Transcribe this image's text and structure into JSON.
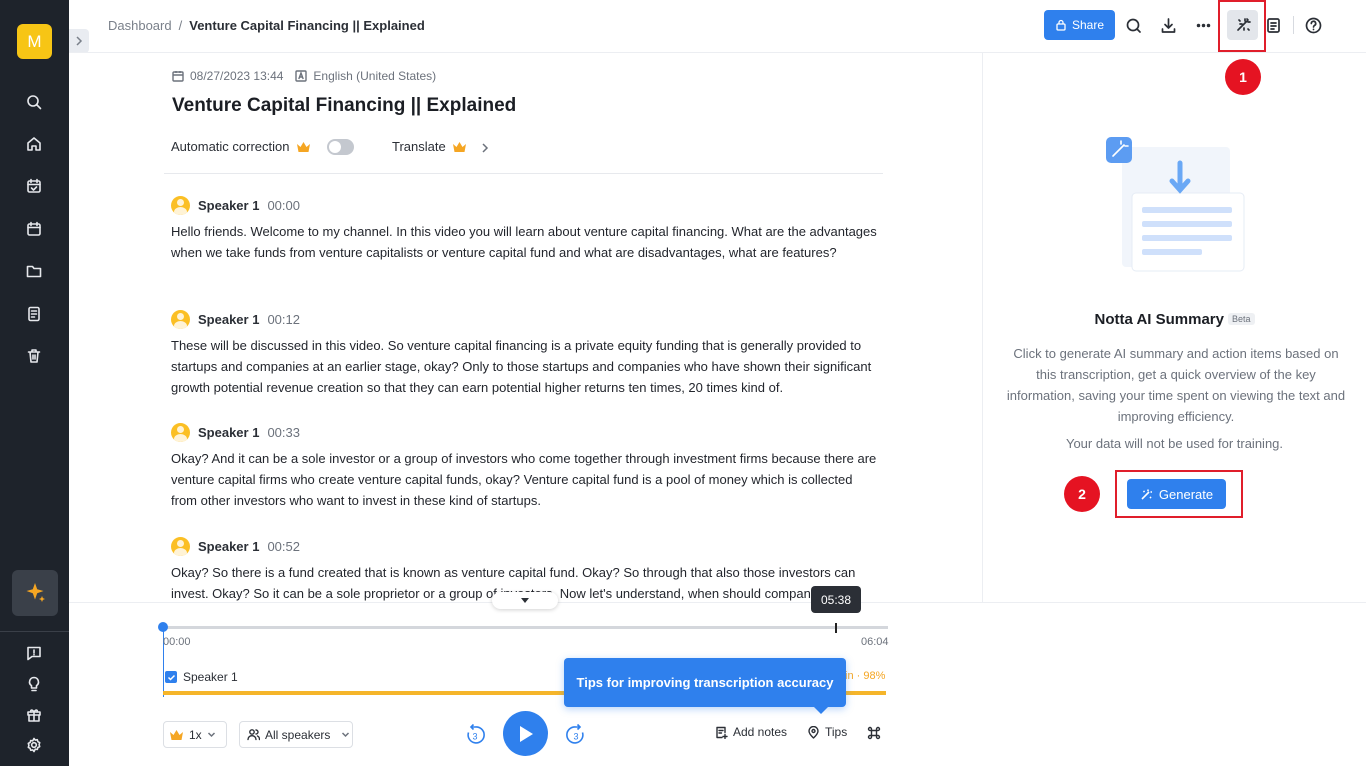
{
  "sidebar": {
    "avatar_letter": "M",
    "nav_icons": [
      "search-icon",
      "home-icon",
      "calendar-check-icon",
      "calendar-icon",
      "folder-icon",
      "notes-icon",
      "trash-icon"
    ],
    "ai_icon": "sparkle-icon",
    "bottom_icons": [
      "feedback-icon",
      "lightbulb-icon",
      "gift-icon",
      "settings-icon"
    ]
  },
  "header": {
    "breadcrumb_root": "Dashboard",
    "breadcrumb_separator": "/",
    "breadcrumb_current": "Venture Capital Financing || Explained",
    "share_label": "Share"
  },
  "annotations": {
    "step1": "1",
    "step2": "2",
    "highlight_color": "#e01e2b"
  },
  "document": {
    "date": "08/27/2023 13:44",
    "language": "English (United States)",
    "title": "Venture Capital Financing || Explained",
    "auto_correction_label": "Automatic correction",
    "translate_label": "Translate"
  },
  "transcript": [
    {
      "speaker": "Speaker 1",
      "time": "00:00",
      "text": "Hello friends. Welcome to my channel. In this video you will learn about venture capital financing. What are the advantages when we take funds from venture capitalists or venture capital fund and what are disadvantages, what are features?"
    },
    {
      "speaker": "Speaker 1",
      "time": "00:12",
      "text": "These will be discussed in this video. So venture capital financing is a private equity funding that is generally provided to startups and companies at an earlier stage, okay? Only to those startups and companies who have shown their significant growth potential revenue creation so that they can earn potential higher returns ten times, 20 times kind of."
    },
    {
      "speaker": "Speaker 1",
      "time": "00:33",
      "text": "Okay? And it can be a sole investor or a group of investors who come together through investment firms because there are venture capital firms who create venture capital funds, okay? Venture capital fund is a pool of money which is collected from other investors who want to invest in these kind of startups."
    },
    {
      "speaker": "Speaker 1",
      "time": "00:52",
      "text": "Okay? So there is a fund created that is known as venture capital fund. Okay? So through that also those investors can invest. Okay? So it can be a sole proprietor or a group of investors. Now let's understand, when should companies go"
    }
  ],
  "summary_panel": {
    "title": "Notta AI Summary",
    "badge": "Beta",
    "description": "Click to generate AI summary and action items based on this transcription, get a quick overview of the key information, saving your time spent on viewing the text and improving efficiency.",
    "note": "Your data will not be used for training.",
    "generate_label": "Generate"
  },
  "player": {
    "hover_time": "05:38",
    "start_time": "00:00",
    "end_time": "06:04",
    "progress": 0,
    "speaker_label": "Speaker 1",
    "speaker_share": "in · 98%",
    "tooltip": "Tips for improving transcription accuracy",
    "speed": "1x",
    "speakers_filter": "All speakers",
    "skip_back": "3",
    "skip_forward": "3",
    "add_notes_label": "Add notes",
    "tips_label": "Tips",
    "accent_color": "#2f80ed",
    "speaker_color": "#f5b52a"
  }
}
